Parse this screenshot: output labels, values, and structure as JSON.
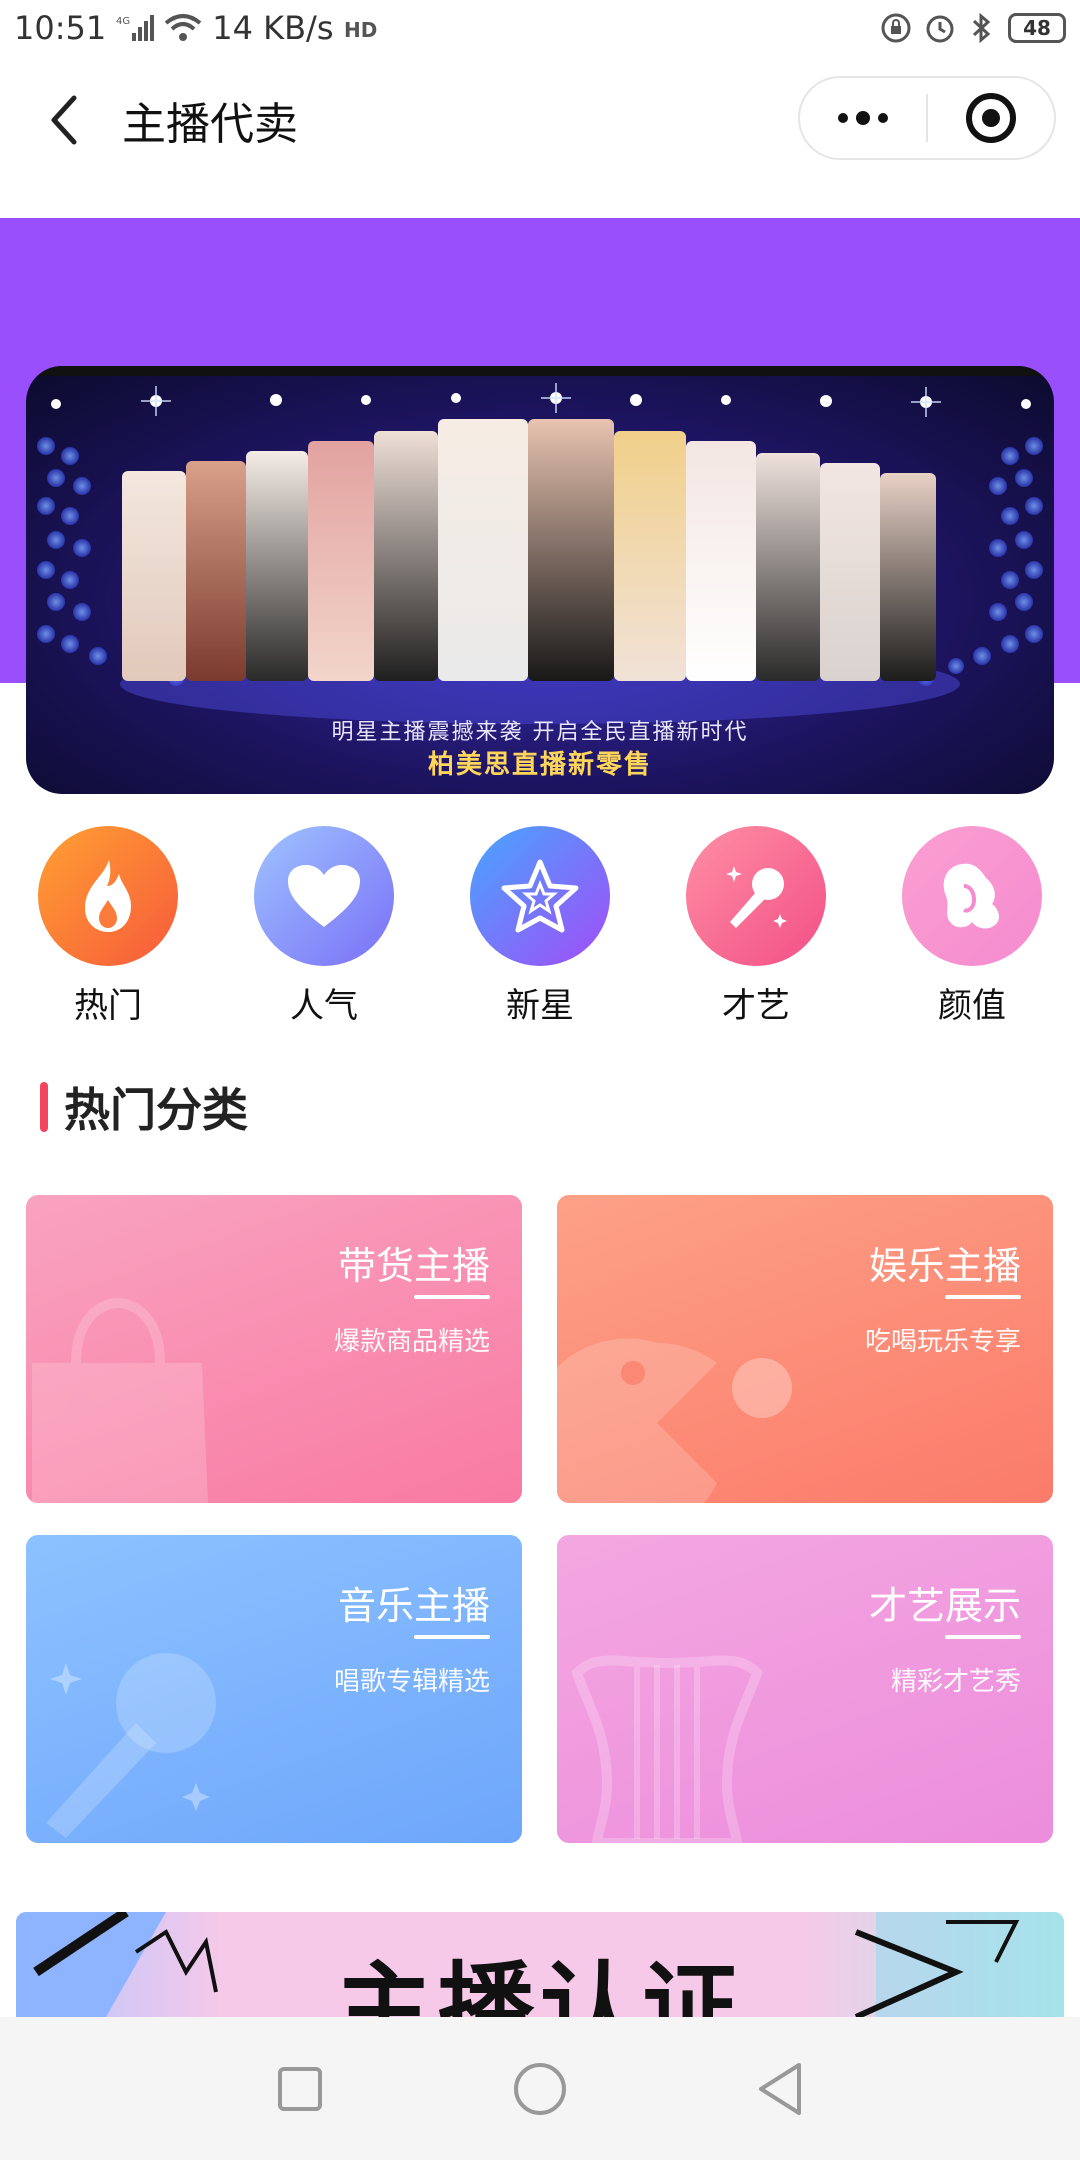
{
  "status_bar": {
    "time": "10:51",
    "network": "4G",
    "speed": "14 KB/s",
    "battery": "48"
  },
  "header": {
    "title": "主播代卖"
  },
  "banner": {
    "caption": "明星主播震撼来袭 开启全民直播新时代",
    "subcaption": "柏美思直播新零售"
  },
  "categories": [
    {
      "label": "热门",
      "icon": "flame-icon",
      "from": "#ffa033",
      "to": "#f75a3b"
    },
    {
      "label": "人气",
      "icon": "heart-icon",
      "from": "#9ec4ff",
      "to": "#7a6ff7"
    },
    {
      "label": "新星",
      "icon": "star-icon",
      "from": "#47a6ff",
      "to": "#a24cf7"
    },
    {
      "label": "才艺",
      "icon": "microphone-icon",
      "from": "#ff8fa5",
      "to": "#f24f86"
    },
    {
      "label": "颜值",
      "icon": "face-icon",
      "from": "#fb9fd1",
      "to": "#f58bd0"
    }
  ],
  "section": {
    "title": "热门分类"
  },
  "cards": [
    {
      "title": "带货主播",
      "subtitle": "爆款商品精选",
      "icon": "shopping-bag-icon",
      "from": "#f9a3c0",
      "to": "#f97aa3"
    },
    {
      "title": "娱乐主播",
      "subtitle": "吃喝玩乐专享",
      "icon": "pacman-icon",
      "from": "#fda187",
      "to": "#fb7b6a"
    },
    {
      "title": "音乐主播",
      "subtitle": "唱歌专辑精选",
      "icon": "microphone-icon",
      "from": "#8dc2ff",
      "to": "#6ea6fb"
    },
    {
      "title": "才艺展示",
      "subtitle": "精彩才艺秀",
      "icon": "harp-icon",
      "from": "#f4a7e1",
      "to": "#ec8ddc"
    }
  ],
  "cert_banner": {
    "text": "主播认证"
  }
}
